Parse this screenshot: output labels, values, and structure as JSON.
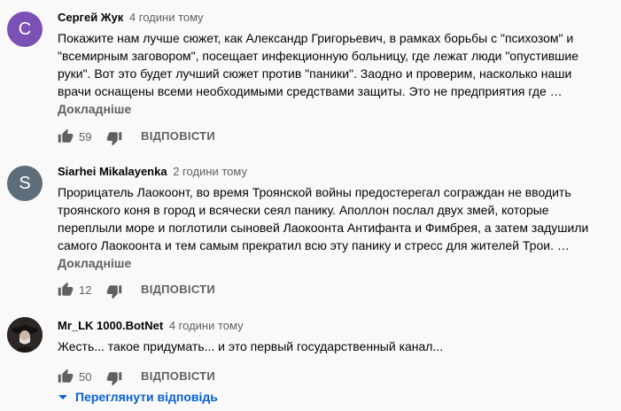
{
  "comments": [
    {
      "author": "Сергей Жук",
      "time": "4 години тому",
      "avatar_letter": "С",
      "avatar_color": "#7b51b5",
      "lines": [
        "Покажите нам лучше сюжет, как Александр Григорьевич, в рамках борьбы с \"психозом\" и",
        "\"всемирным заговором\", посещает инфекционную больницу, где лежат люди \"опустившие",
        "руки\". Вот это будет лучший сюжет против \"паники\". Заодно и проверим, насколько наши",
        "врачи оснащены всеми необходимыми средствами защиты. Это не предприятия где …"
      ],
      "more_label": "Докладніше",
      "likes": "59",
      "reply_label": "ВІДПОВІСТИ"
    },
    {
      "author": "Siarhei Mikalayenka",
      "time": "2 години тому",
      "avatar_letter": "S",
      "avatar_color": "#5d6e7a",
      "lines": [
        "Прорицатель Лаокоонт, во время Троянской войны предостерегал сограждан не вводить",
        "троянского коня в город и всячески сеял панику. Аполлон послал двух змей, которые",
        "переплыли море и поглотили сыновей Лаокоонта Антифанта и Фимбрея, а затем задушили",
        "самого Лаокоонта и тем самым прекратил всю эту панику и стресс для жителей Трои. …"
      ],
      "more_label": "Докладніше",
      "likes": "12",
      "reply_label": "ВІДПОВІСТИ"
    },
    {
      "author": "Mr_LK 1000.BotNet",
      "time": "4 години тому",
      "avatar_letter": "",
      "avatar_color": "#3a3230",
      "lines": [
        "Жесть... такое придумать... и это первый государственный канал..."
      ],
      "more_label": "",
      "likes": "50",
      "reply_label": "ВІДПОВІСТИ"
    }
  ],
  "view_replies_label": "Переглянути відповідь",
  "colors": {
    "link_blue": "#065fd4",
    "secondary_text": "#606060",
    "background": "#f9f9f9"
  }
}
